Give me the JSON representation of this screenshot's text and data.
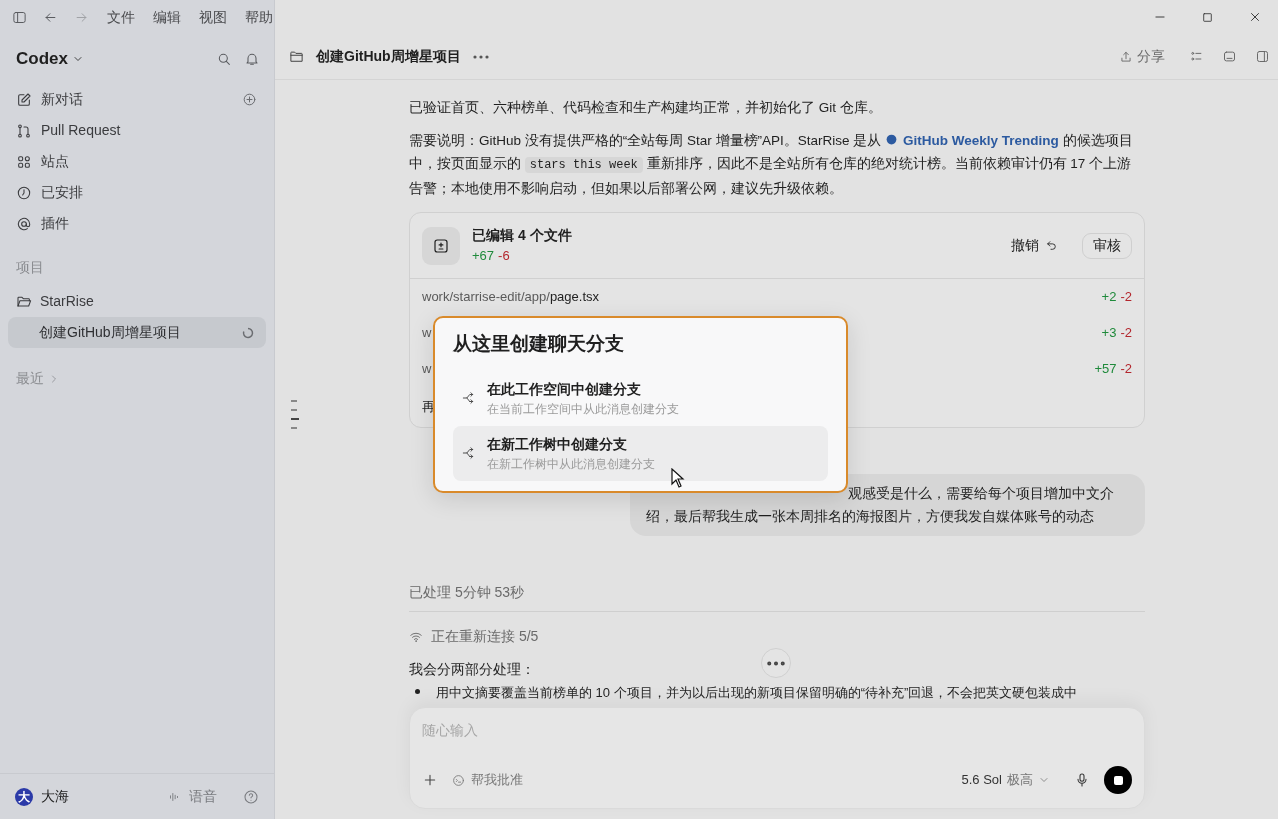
{
  "menu_bar": {
    "items": [
      "文件",
      "编辑",
      "视图",
      "帮助"
    ]
  },
  "sidebar": {
    "app_name": "Codex",
    "nav": [
      {
        "kind": "compose",
        "label": "新对话"
      },
      {
        "kind": "pull",
        "label": "Pull Request"
      },
      {
        "kind": "sites",
        "label": "站点"
      },
      {
        "kind": "clock",
        "label": "已安排"
      },
      {
        "kind": "at",
        "label": "插件"
      }
    ],
    "projects_label": "项目",
    "projects": [
      {
        "name": "StarRise",
        "children": [
          {
            "title": "创建GitHub周增星项目",
            "selected": true,
            "running": true
          }
        ]
      }
    ],
    "recent_label": "最近",
    "user": {
      "initial": "大",
      "name": "大海"
    },
    "voice_label": "语音"
  },
  "header": {
    "title": "创建GitHub周增星项目",
    "share_label": "分享"
  },
  "paragraphs": [
    [
      {
        "kind": "text",
        "text": "已验证首页、六种榜单、代码检查和生产构建均正常，并初始化了 Git 仓库。"
      }
    ],
    [
      {
        "kind": "text",
        "text": "需要说明：GitHub 没有提供严格的“全站每周 Star 增量榜”API。StarRise 是从 "
      },
      {
        "kind": "link",
        "text": "GitHub Weekly Trending"
      },
      {
        "kind": "text",
        "text": " 的候选项目中，按页面显示的 "
      },
      {
        "kind": "code",
        "text": "stars this week"
      },
      {
        "kind": "text",
        "text": " 重新排序，因此不是全站所有仓库的绝对统计榜。当前依赖审计仍有 17 个上游告警；本地使用不影响启动，但如果以后部署公网，建议先升级依赖。"
      }
    ]
  ],
  "changes": {
    "title": "已编辑 4 个文件",
    "added": "+67",
    "removed": "-6",
    "undo_label": "撤销",
    "review_label": "审核",
    "files": [
      {
        "dir": "work/starrise-edit/app/",
        "name": "page.tsx",
        "added": "+2",
        "removed": "-2"
      },
      {
        "dir": "w",
        "added": "+3",
        "removed": "-2"
      },
      {
        "dir": "w",
        "added": "+57",
        "removed": "-2"
      }
    ],
    "more": "再"
  },
  "branch_popup": {
    "title": "从这里创建聊天分支",
    "options": [
      {
        "title": "在此工作空间中创建分支",
        "subtitle": "在当前工作空间中从此消息创建分支",
        "selected": false
      },
      {
        "title": "在新工作树中创建分支",
        "subtitle": "在新工作树中从此消息创建分支",
        "selected": true
      }
    ]
  },
  "user_message": {
    "lines": [
      "观感受是什么，需要给每个项目增加中文介",
      "绍，最后帮我生成一张本周排名的海报图片，方便我发自媒体账号的动态"
    ]
  },
  "worked_for": "已处理 5分钟 53秒",
  "reconnect": "正在重新连接 5/5",
  "reply_intro": "我会分两部分处理：",
  "reply_bullets": [
    "用中文摘要覆盖当前榜单的 10 个项目，并为以后出现的新项目保留明确的“待补充”回退，不会把英文硬包装成中"
  ],
  "composer": {
    "placeholder": "随心输入",
    "approve_label": "帮我批准",
    "model": "5.6 Sol",
    "effort": "极高",
    "running": true
  }
}
